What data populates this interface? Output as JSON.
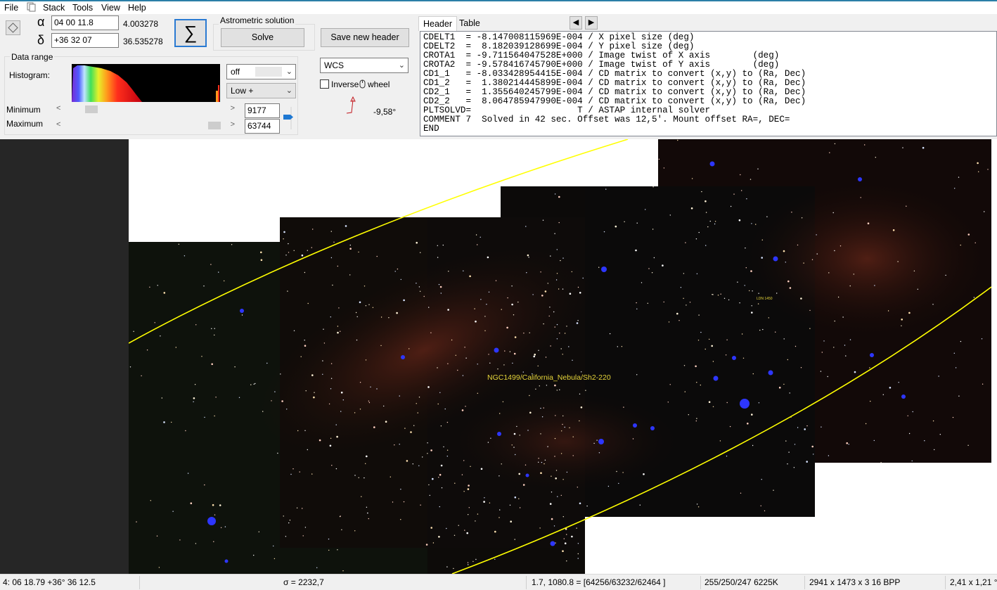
{
  "menu": [
    "File",
    "Stack",
    "Tools",
    "View",
    "Help"
  ],
  "coords": {
    "alpha_symbol": "α",
    "delta_symbol": "δ",
    "ra_value": "04 00 11.8",
    "dec_value": "+36 32 07",
    "ra_decimal": "4.003278",
    "dec_decimal": "36.535278"
  },
  "sigma_symbol": "∑",
  "astrometric": {
    "title": "Astrometric solution",
    "solve_label": "Solve"
  },
  "save_header_label": "Save new header",
  "data_range": {
    "title": "Data range",
    "histogram_label": "Histogram:",
    "minimum_label": "Minimum",
    "maximum_label": "Maximum",
    "minimum_value": "9177",
    "maximum_value": "63744",
    "stretch_option": "off",
    "range_option": "Low +"
  },
  "wcs": {
    "selected": "WCS",
    "inverse_label": "Inverse",
    "wheel_label": "wheel",
    "rotation": "-9,58°"
  },
  "tabs": [
    "Header",
    "Table"
  ],
  "header_lines": [
    "CDELT1  = -8.147008115969E-004 / X pixel size (deg)",
    "CDELT2  =  8.182039128699E-004 / Y pixel size (deg)",
    "CROTA1  = -9.711564047528E+000 / Image twist of X axis        (deg)",
    "CROTA2  = -9.578416745790E+000 / Image twist of Y axis        (deg)",
    "CD1_1   = -8.033428954415E-004 / CD matrix to convert (x,y) to (Ra, Dec)",
    "CD1_2   =  1.380214445899E-004 / CD matrix to convert (x,y) to (Ra, Dec)",
    "CD2_1   =  1.355640245799E-004 / CD matrix to convert (x,y) to (Ra, Dec)",
    "CD2_2   =  8.064785947990E-004 / CD matrix to convert (x,y) to (Ra, Dec)",
    "PLTSOLVD=                    T / ASTAP internal solver",
    "COMMENT 7  Solved in 42 sec. Offset was 12,5'. Mount offset RA=, DEC=",
    "END"
  ],
  "image": {
    "annotation": "NGC1499/California_Nebula/Sh2-220",
    "small_annotation": "LDN 1450"
  },
  "status": {
    "cursor_coords": "4: 06  18.79   +36° 36  12.5",
    "sigma": "σ = 2232,7",
    "pixel_value": "1.7, 1080.8 = [64256/63232/62464 ]",
    "rgb": "255/250/247  6225K",
    "dimensions": "2941 x 1473 x 3   16 BPP",
    "scale": "2,41 x 1,21 °"
  }
}
